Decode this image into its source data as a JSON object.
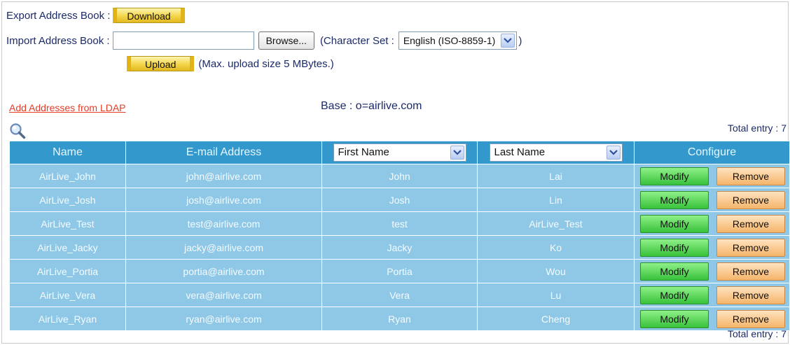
{
  "export": {
    "label": "Export Address Book :",
    "button": "Download"
  },
  "import": {
    "label": "Import Address Book :",
    "file_value": "",
    "browse": "Browse...",
    "charset_label": "(Character Set :",
    "charset_value": "English (ISO-8859-1)",
    "charset_close": ")",
    "upload": "Upload",
    "upload_note": "(Max. upload size 5 MBytes.)"
  },
  "ldap_link": "Add Addresses from LDAP",
  "base": "Base : o=airlive.com",
  "total_top": "Total entry : 7",
  "total_bottom": "Total entry : 7",
  "table": {
    "headers": {
      "name": "Name",
      "email": "E-mail Address",
      "first_name": "First Name",
      "last_name": "Last Name",
      "configure": "Configure"
    },
    "modify_label": "Modify",
    "remove_label": "Remove",
    "rows": [
      {
        "name": "AirLive_John",
        "email": "john@airlive.com",
        "first": "John",
        "last": "Lai"
      },
      {
        "name": "AirLive_Josh",
        "email": "josh@airlive.com",
        "first": "Josh",
        "last": "Lin"
      },
      {
        "name": "AirLive_Test",
        "email": "test@airlive.com",
        "first": "test",
        "last": "AirLive_Test"
      },
      {
        "name": "AirLive_Jacky",
        "email": "jacky@airlive.com",
        "first": "Jacky",
        "last": "Ko"
      },
      {
        "name": "AirLive_Portia",
        "email": "portia@airlive.com",
        "first": "Portia",
        "last": "Wou"
      },
      {
        "name": "AirLive_Vera",
        "email": "vera@airlive.com",
        "first": "Vera",
        "last": "Lu"
      },
      {
        "name": "AirLive_Ryan",
        "email": "ryan@airlive.com",
        "first": "Ryan",
        "last": "Cheng"
      }
    ]
  },
  "icons": {
    "search": "search-icon",
    "dropdown": "chevron-down-icon"
  },
  "colors": {
    "header_bg": "#3399cc",
    "row_bg": "#8ec8e6",
    "link": "#e53d2a",
    "modify": "#38c23a",
    "remove": "#f5b46a"
  }
}
